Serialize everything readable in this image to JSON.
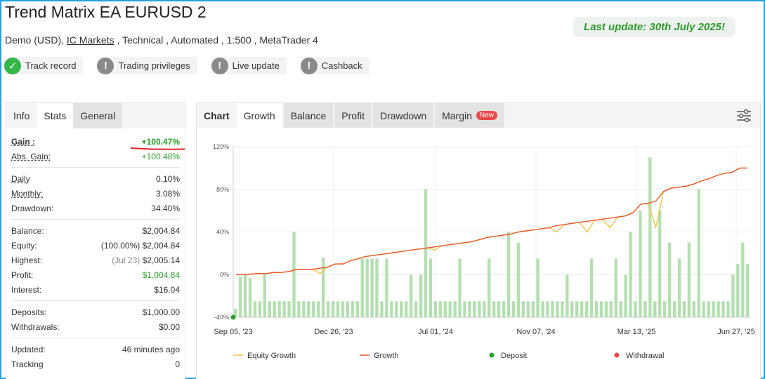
{
  "header": {
    "title": "Trend Matrix EA EURUSD 2",
    "sub_prefix": "Demo (USD),",
    "broker": "IC Markets",
    "sub_suffix": ", Technical , Automated , 1:500 , MetaTrader 4",
    "last_update": "Last update: 30th July 2025!"
  },
  "badges": [
    {
      "label": "Track record",
      "icon": "check-icon",
      "status": "verified"
    },
    {
      "label": "Trading privileges",
      "icon": "exclamation-icon",
      "status": "unverified"
    },
    {
      "label": "Live update",
      "icon": "exclamation-icon",
      "status": "unverified"
    },
    {
      "label": "Cashback",
      "icon": "exclamation-icon",
      "status": "unverified"
    }
  ],
  "left_tabs": [
    "Info",
    "Stats",
    "General"
  ],
  "stats": {
    "gain_label": "Gain :",
    "gain": "+100.47%",
    "abs_gain_label": "Abs. Gain:",
    "abs_gain": "+100.48%",
    "daily_label": "Daily",
    "daily": "0.10%",
    "monthly_label": "Monthly:",
    "monthly": "3.08%",
    "drawdown_label": "Drawdown:",
    "drawdown": "34.40%",
    "balance_label": "Balance:",
    "balance": "$2,004.84",
    "equity_label": "Equity:",
    "equity_pct": "(100.00%)",
    "equity": "$2,004.84",
    "highest_label": "Highest:",
    "highest_date": "(Jul 23)",
    "highest": "$2,005.14",
    "profit_label": "Profit:",
    "profit": "$1,004.84",
    "interest_label": "Interest:",
    "interest": "$16.04",
    "deposits_label": "Deposits:",
    "deposits": "$1,000.00",
    "withdrawals_label": "Withdrawals:",
    "withdrawals": "$0.00",
    "updated_label": "Updated:",
    "updated": "46 minutes ago",
    "tracking_label": "Tracking",
    "tracking": "0"
  },
  "right_tabs": {
    "chart": "Chart",
    "growth": "Growth",
    "balance": "Balance",
    "profit": "Profit",
    "drawdown": "Drawdown",
    "margin": "Margin",
    "new_badge": "New"
  },
  "colors": {
    "accent_border": "#1fa3e8",
    "green": "#2ca02c",
    "equity_growth": "#f2c744",
    "growth": "#e8562a",
    "deposit": "#2ca02c",
    "withdrawal": "#e84a4a",
    "bars": "#b5dfb1"
  },
  "chart_data": {
    "type": "line",
    "y_ticks": [
      "120%",
      "80%",
      "40%",
      "0%",
      "-40%"
    ],
    "ylim": [
      -40,
      120
    ],
    "x_ticks": [
      "Sep 05, '23",
      "Dec 26, '23",
      "Jul 01, '24",
      "Nov 07, '24",
      "Mar 13, '25",
      "Jun 27, '25"
    ],
    "legend": [
      "Equity Growth",
      "Growth",
      "Deposit",
      "Withdrawal"
    ],
    "legend_placement": "bottom",
    "grid": true,
    "growth_series": [
      0,
      0,
      0.5,
      1,
      1,
      2,
      2,
      3,
      5,
      5,
      5,
      6,
      7,
      10,
      10,
      13,
      15,
      17,
      18,
      19,
      20,
      21,
      22,
      23,
      24,
      25,
      26,
      27,
      28,
      29,
      30,
      31,
      33,
      35,
      36,
      37,
      38,
      40,
      41,
      42,
      43,
      44,
      46,
      47,
      48,
      49,
      50,
      51,
      52,
      53,
      54,
      55,
      58,
      66,
      67,
      69,
      78,
      81,
      82,
      83,
      85,
      88,
      90,
      93,
      95,
      96,
      100,
      100
    ],
    "equity_dips": [
      [
        11,
        1
      ],
      [
        26,
        23
      ],
      [
        42,
        40
      ],
      [
        46,
        40
      ],
      [
        49,
        44
      ],
      [
        55,
        44
      ],
      [
        79,
        77
      ],
      [
        85,
        83
      ]
    ],
    "deposit_points": [
      {
        "x": 0,
        "y": -40
      }
    ],
    "bar_values": [
      -32,
      -2,
      0,
      -3,
      -25,
      -25,
      0,
      -25,
      -25,
      -25,
      -25,
      -25,
      40,
      -25,
      -25,
      -25,
      -25,
      -25,
      16,
      -25,
      -25,
      -25,
      -25,
      -25,
      -25,
      -25,
      15,
      15,
      15,
      15,
      -25,
      15,
      -25,
      -25,
      -25,
      -25,
      0,
      -25,
      0,
      80,
      15,
      -25,
      -25,
      -25,
      -25,
      -25,
      15,
      -25,
      -25,
      -25,
      -25,
      -25,
      15,
      -25,
      -25,
      -25,
      40,
      -25,
      30,
      -25,
      -25,
      -25,
      15,
      -25,
      -25,
      -25,
      -25,
      -25,
      0,
      -25,
      -25,
      -25,
      -25,
      15,
      -25,
      -25,
      -25,
      -25,
      15,
      -25,
      0,
      40,
      -25,
      60,
      -25,
      110,
      -25,
      60,
      -25,
      30,
      -25,
      15,
      -25,
      30,
      -25,
      80,
      -25,
      -25,
      -25,
      -25,
      -25,
      -25,
      0,
      10,
      30,
      10
    ]
  }
}
